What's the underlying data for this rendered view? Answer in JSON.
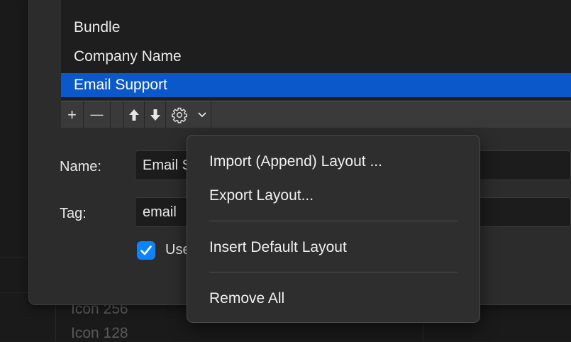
{
  "background_list": {
    "items": [
      "Icon 256",
      "Icon 128"
    ]
  },
  "layout_list": {
    "items": [
      {
        "label": "Bundle",
        "selected": false
      },
      {
        "label": "Company Name",
        "selected": false
      },
      {
        "label": "Email Support",
        "selected": true
      }
    ]
  },
  "toolbar": {
    "buttons": [
      {
        "name": "add",
        "label": "+"
      },
      {
        "name": "remove",
        "label": "—"
      },
      {
        "name": "move-up",
        "icon": "arrow-up-icon"
      },
      {
        "name": "move-down",
        "icon": "arrow-down-icon"
      },
      {
        "name": "actions",
        "icon": "gear-icon"
      },
      {
        "name": "actions-menu",
        "icon": "chevron-down-icon"
      }
    ]
  },
  "form": {
    "name_label": "Name:",
    "name_value": "Email Support",
    "tag_label": "Tag:",
    "tag_value": "email",
    "checkbox_label": "Use",
    "checkbox_checked": true
  },
  "menu": {
    "items": [
      "Import (Append) Layout ...",
      "Export Layout...",
      "Insert Default Layout",
      "Remove All"
    ]
  },
  "colors": {
    "selection": "#0a58ca",
    "checkbox": "#0a84ff",
    "panel": "#2c2c2c",
    "menu": "#2e2e2e"
  }
}
